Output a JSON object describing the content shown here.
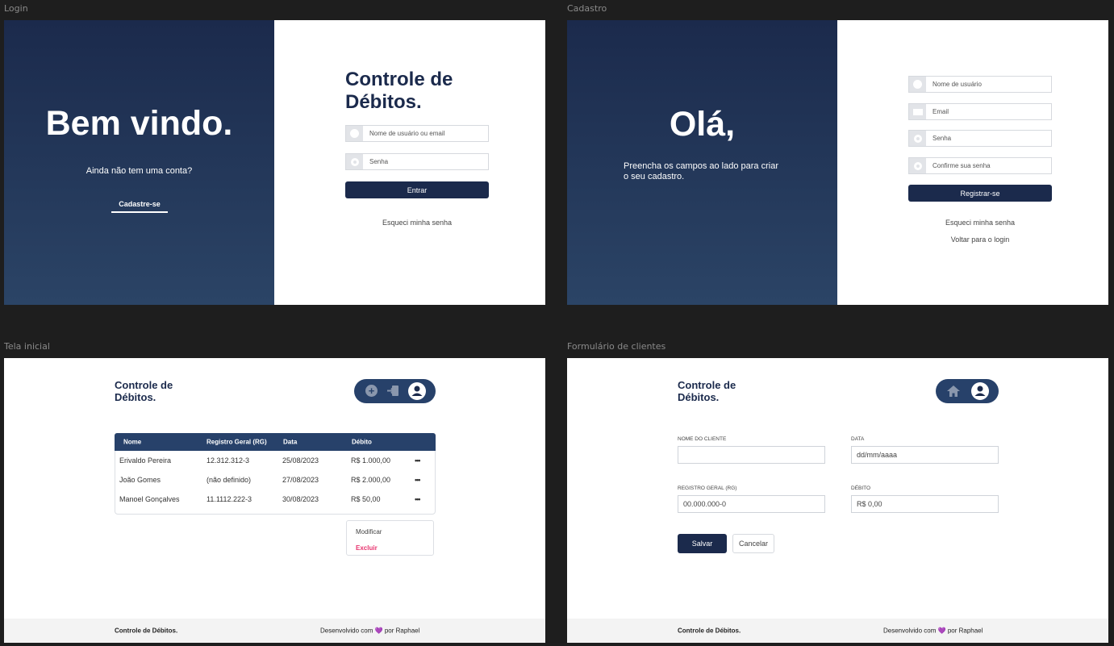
{
  "frames": {
    "login": "Login",
    "cadastro": "Cadastro",
    "tela_inicial": "Tela inicial",
    "formulario": "Formulário de clientes"
  },
  "login": {
    "welcome": "Bem vindo.",
    "no_account": "Ainda não tem uma conta?",
    "signup_link": "Cadastre-se",
    "app_title_line1": "Controle de",
    "app_title_line2": "Débitos.",
    "user_placeholder": "Nome de usuário ou email",
    "password_placeholder": "Senha",
    "submit": "Entrar",
    "forgot": "Esqueci minha senha"
  },
  "cadastro": {
    "hello": "Olá,",
    "instructions_line1": "Preencha os campos ao lado para criar",
    "instructions_line2": "o seu cadastro.",
    "username_placeholder": "Nome de usuário",
    "email_placeholder": "Email",
    "password_placeholder": "Senha",
    "confirm_placeholder": "Confirme sua senha",
    "submit": "Registrar-se",
    "forgot": "Esqueci minha senha",
    "back_login": "Voltar para o login"
  },
  "home": {
    "title_line1": "Controle de",
    "title_line2": "Débitos.",
    "columns": [
      "Nome",
      "Registro Geral (RG)",
      "Data",
      "Débito"
    ],
    "rows": [
      {
        "nome": "Erivaldo Pereira",
        "rg": "12.312.312-3",
        "data": "25/08/2023",
        "debito": "R$ 1.000,00"
      },
      {
        "nome": "João Gomes",
        "rg": "(não definido)",
        "data": "27/08/2023",
        "debito": "R$ 2.000,00"
      },
      {
        "nome": "Manoel Gonçalves",
        "rg": "11.1112.222-3",
        "data": "30/08/2023",
        "debito": "R$ 50,00"
      }
    ],
    "row_menu_glyph": "•••",
    "menu": {
      "modify": "Modificar",
      "delete": "Excluir"
    },
    "delete_color": "#e8336e"
  },
  "form": {
    "title_line1": "Controle de",
    "title_line2": "Débitos.",
    "client_label": "NOME DO CLIENTE",
    "client_value": "",
    "date_label": "DATA",
    "date_value": "dd/mm/aaaa",
    "rg_label": "REGISTRO GERAL (RG)",
    "rg_value": "00.000.000-0",
    "debit_label": "DÉBITO",
    "debit_value": "R$ 0,00",
    "save": "Salvar",
    "cancel": "Cancelar"
  },
  "footer": {
    "brand": "Controle de Débitos.",
    "credit_prefix": "Desenvolvido com",
    "heart": "💜",
    "credit_suffix": "por Raphael"
  },
  "colors": {
    "navy": "#1b2a4c",
    "table_header": "#27416a",
    "heart": "#9b5de5"
  },
  "icons": [
    "user-icon",
    "key-icon",
    "envelope-icon",
    "plus-circle-icon",
    "logout-icon",
    "profile-icon",
    "home-icon"
  ]
}
